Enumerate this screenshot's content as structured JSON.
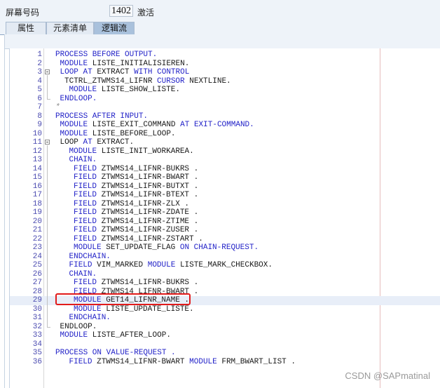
{
  "header": {
    "screen_label": "屏幕号码",
    "screen_number": "1402",
    "screen_status": "激活"
  },
  "tabs": [
    {
      "label": "属性",
      "active": false
    },
    {
      "label": "元素清单",
      "active": false
    },
    {
      "label": "逻辑流",
      "active": true
    }
  ],
  "code": [
    {
      "n": "1",
      "indent": 0,
      "tokens": [
        [
          "kw",
          "PROCESS BEFORE OUTPUT."
        ]
      ]
    },
    {
      "n": "2",
      "indent": 1,
      "tokens": [
        [
          "kw",
          "MODULE "
        ],
        [
          "id",
          "LISTE_INITIALISIEREN."
        ]
      ]
    },
    {
      "n": "3",
      "indent": 1,
      "fold": true,
      "tokens": [
        [
          "kw",
          "LOOP AT "
        ],
        [
          "id",
          "EXTRACT "
        ],
        [
          "kw",
          "WITH CONTROL"
        ]
      ]
    },
    {
      "n": "4",
      "indent": 2,
      "tokens": [
        [
          "id",
          "TCTRL_ZTWMS14_LIFNR "
        ],
        [
          "kw",
          "CURSOR "
        ],
        [
          "id",
          "NEXTLINE."
        ]
      ]
    },
    {
      "n": "5",
      "indent": 3,
      "tokens": [
        [
          "kw",
          "MODULE "
        ],
        [
          "id",
          "LISTE_SHOW_LISTE."
        ]
      ]
    },
    {
      "n": "6",
      "indent": 1,
      "tokens": [
        [
          "kw",
          "ENDLOOP."
        ]
      ]
    },
    {
      "n": "7",
      "indent": 0,
      "tokens": [
        [
          "cm",
          "*"
        ]
      ]
    },
    {
      "n": "8",
      "indent": 0,
      "tokens": [
        [
          "kw",
          "PROCESS AFTER INPUT."
        ]
      ]
    },
    {
      "n": "9",
      "indent": 1,
      "tokens": [
        [
          "kw",
          "MODULE "
        ],
        [
          "id",
          "LISTE_EXIT_COMMAND "
        ],
        [
          "kw",
          "AT EXIT-COMMAND."
        ]
      ]
    },
    {
      "n": "10",
      "indent": 1,
      "tokens": [
        [
          "kw",
          "MODULE "
        ],
        [
          "id",
          "LISTE_BEFORE_LOOP."
        ]
      ]
    },
    {
      "n": "11",
      "indent": 1,
      "fold": true,
      "tokens": [
        [
          "id",
          "LOOP "
        ],
        [
          "kw",
          "AT "
        ],
        [
          "id",
          "EXTRACT."
        ]
      ]
    },
    {
      "n": "12",
      "indent": 3,
      "tokens": [
        [
          "kw",
          "MODULE "
        ],
        [
          "id",
          "LISTE_INIT_WORKAREA."
        ]
      ]
    },
    {
      "n": "13",
      "indent": 3,
      "tokens": [
        [
          "kw",
          "CHAIN."
        ]
      ]
    },
    {
      "n": "14",
      "indent": 4,
      "tokens": [
        [
          "kw",
          "FIELD "
        ],
        [
          "id",
          "ZTWMS14_LIFNR-BUKRS ."
        ]
      ]
    },
    {
      "n": "15",
      "indent": 4,
      "tokens": [
        [
          "kw",
          "FIELD "
        ],
        [
          "id",
          "ZTWMS14_LIFNR-BWART ."
        ]
      ]
    },
    {
      "n": "16",
      "indent": 4,
      "tokens": [
        [
          "kw",
          "FIELD "
        ],
        [
          "id",
          "ZTWMS14_LIFNR-BUTXT ."
        ]
      ]
    },
    {
      "n": "17",
      "indent": 4,
      "tokens": [
        [
          "kw",
          "FIELD "
        ],
        [
          "id",
          "ZTWMS14_LIFNR-BTEXT ."
        ]
      ]
    },
    {
      "n": "18",
      "indent": 4,
      "tokens": [
        [
          "kw",
          "FIELD "
        ],
        [
          "id",
          "ZTWMS14_LIFNR-ZLX ."
        ]
      ]
    },
    {
      "n": "19",
      "indent": 4,
      "tokens": [
        [
          "kw",
          "FIELD "
        ],
        [
          "id",
          "ZTWMS14_LIFNR-ZDATE ."
        ]
      ]
    },
    {
      "n": "20",
      "indent": 4,
      "tokens": [
        [
          "kw",
          "FIELD "
        ],
        [
          "id",
          "ZTWMS14_LIFNR-ZTIME ."
        ]
      ]
    },
    {
      "n": "21",
      "indent": 4,
      "tokens": [
        [
          "kw",
          "FIELD "
        ],
        [
          "id",
          "ZTWMS14_LIFNR-ZUSER ."
        ]
      ]
    },
    {
      "n": "22",
      "indent": 4,
      "tokens": [
        [
          "kw",
          "FIELD "
        ],
        [
          "id",
          "ZTWMS14_LIFNR-ZSTART ."
        ]
      ]
    },
    {
      "n": "23",
      "indent": 4,
      "tokens": [
        [
          "kw",
          "MODULE "
        ],
        [
          "id",
          "SET_UPDATE_FLAG "
        ],
        [
          "kw",
          "ON CHAIN-REQUEST."
        ]
      ]
    },
    {
      "n": "24",
      "indent": 3,
      "tokens": [
        [
          "kw",
          "ENDCHAIN."
        ]
      ]
    },
    {
      "n": "25",
      "indent": 3,
      "tokens": [
        [
          "kw",
          "FIELD "
        ],
        [
          "id",
          "VIM_MARKED "
        ],
        [
          "kw",
          "MODULE "
        ],
        [
          "id",
          "LISTE_MARK_CHECKBOX."
        ]
      ]
    },
    {
      "n": "26",
      "indent": 3,
      "tokens": [
        [
          "kw",
          "CHAIN."
        ]
      ]
    },
    {
      "n": "27",
      "indent": 4,
      "tokens": [
        [
          "kw",
          "FIELD "
        ],
        [
          "id",
          "ZTWMS14_LIFNR-BUKRS ."
        ]
      ]
    },
    {
      "n": "28",
      "indent": 4,
      "tokens": [
        [
          "kw",
          "FIELD "
        ],
        [
          "id",
          "ZTWMS14_LIFNR-BWART ."
        ]
      ]
    },
    {
      "n": "29",
      "indent": 4,
      "highlight": true,
      "tokens": [
        [
          "kw",
          "MODULE "
        ],
        [
          "id",
          "GET14_LIFNR_NAME ."
        ]
      ]
    },
    {
      "n": "30",
      "indent": 4,
      "tokens": [
        [
          "kw",
          "MODULE "
        ],
        [
          "id",
          "LISTE_UPDATE_LISTE."
        ]
      ]
    },
    {
      "n": "31",
      "indent": 3,
      "tokens": [
        [
          "kw",
          "ENDCHAIN."
        ]
      ]
    },
    {
      "n": "32",
      "indent": 1,
      "tokens": [
        [
          "id",
          "ENDLOOP."
        ]
      ]
    },
    {
      "n": "33",
      "indent": 1,
      "tokens": [
        [
          "kw",
          "MODULE "
        ],
        [
          "id",
          "LISTE_AFTER_LOOP."
        ]
      ]
    },
    {
      "n": "34",
      "indent": 0,
      "tokens": []
    },
    {
      "n": "35",
      "indent": 0,
      "tokens": [
        [
          "kw",
          "PROCESS ON VALUE-REQUEST ."
        ]
      ]
    },
    {
      "n": "36",
      "indent": 3,
      "tokens": [
        [
          "kw",
          "FIELD "
        ],
        [
          "id",
          "ZTWMS14_LIFNR-BWART "
        ],
        [
          "kw",
          "MODULE "
        ],
        [
          "id",
          "FRM_BWART_LIST ."
        ]
      ]
    }
  ],
  "watermark": "CSDN @SAPmatinal"
}
